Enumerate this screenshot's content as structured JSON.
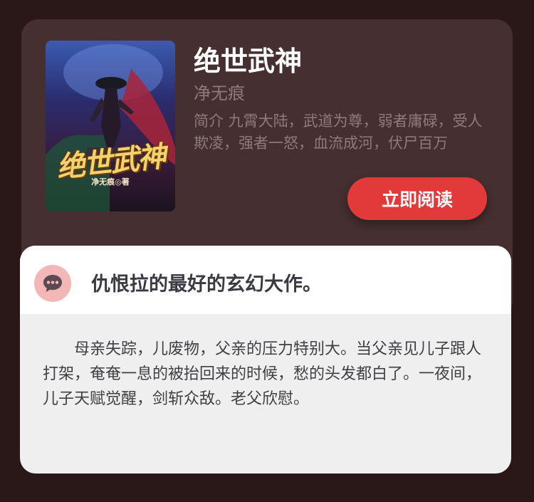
{
  "book": {
    "title": "绝世武神",
    "author": "净无痕",
    "intro": "简介 九霄大陆，武道为尊，弱者庸碌，受人欺凌，强者一怒，血流成河，伏尸百万",
    "read_button_label": "立即阅读",
    "cover": {
      "title_text": "绝世武神",
      "author_text": "净无痕◎著"
    }
  },
  "review": {
    "icon": "comment-dots-icon",
    "title": "仇恨拉的最好的玄幻大作。",
    "body": "母亲失踪，儿废物，父亲的压力特别大。当父亲见儿子跟人打架，奄奄一息的被抬回来的时候，愁的头发都白了。一夜间，儿子天赋觉醒，剑斩众敌。老父欣慰。"
  },
  "colors": {
    "background": "#2a1718",
    "card": "#452f30",
    "accent": "#e2393b",
    "icon_bg": "#f4b7b8"
  }
}
